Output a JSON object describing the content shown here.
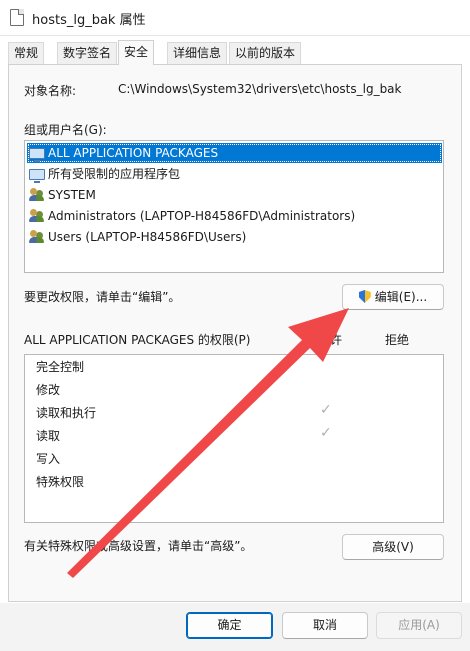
{
  "window": {
    "title": "hosts_lg_bak 属性"
  },
  "tabs": [
    {
      "label": "常规"
    },
    {
      "label": "数字签名"
    },
    {
      "label": "安全"
    },
    {
      "label": "详细信息"
    },
    {
      "label": "以前的版本"
    }
  ],
  "security": {
    "object_name_label": "对象名称:",
    "object_name_value": "C:\\Windows\\System32\\drivers\\etc\\hosts_lg_bak",
    "group_label": "组或用户名(G):",
    "users": [
      {
        "label": "ALL APPLICATION PACKAGES",
        "icon": "app-packages-icon",
        "selected": true
      },
      {
        "label": "所有受限制的应用程序包",
        "icon": "app-packages-icon"
      },
      {
        "label": "SYSTEM",
        "icon": "users-group-icon"
      },
      {
        "label": "Administrators (LAPTOP-H84586FD\\Administrators)",
        "icon": "users-group-icon"
      },
      {
        "label": "Users (LAPTOP-H84586FD\\Users)",
        "icon": "users-group-icon"
      }
    ],
    "change_hint": "要更改权限，请单击“编辑”。",
    "edit_button": "编辑(E)...",
    "permissions_label": "ALL APPLICATION PACKAGES 的权限(P)",
    "allow_header": "允许",
    "deny_header": "拒绝",
    "permissions": [
      {
        "name": "完全控制",
        "allow": false,
        "deny": false
      },
      {
        "name": "修改",
        "allow": false,
        "deny": false
      },
      {
        "name": "读取和执行",
        "allow": true,
        "deny": false
      },
      {
        "name": "读取",
        "allow": true,
        "deny": false
      },
      {
        "name": "写入",
        "allow": false,
        "deny": false
      },
      {
        "name": "特殊权限",
        "allow": false,
        "deny": false
      }
    ],
    "advanced_hint": "有关特殊权限或高级设置，请单击“高级”。",
    "advanced_button": "高级(V)"
  },
  "footer": {
    "ok_button": "确定",
    "cancel_button": "取消",
    "apply_button": "应用(A)"
  },
  "colors": {
    "selection": "#0078d4",
    "annotation_arrow": "#f04848"
  }
}
